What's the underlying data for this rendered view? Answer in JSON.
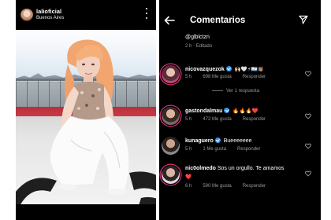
{
  "post": {
    "username": "lalioficial",
    "location": "Buenos Aires",
    "icons": {
      "avatar": "avatar",
      "menu": "more-options-icon"
    }
  },
  "comments_panel": {
    "title": "Comentarios",
    "icons": {
      "back": "back-arrow-icon",
      "share": "send-icon",
      "like": "heart-icon"
    },
    "op_comment": {
      "text": "@glblctzn",
      "time": "2 h",
      "separator": "·",
      "edited": "Editado"
    },
    "view_replies": "Ver 1 respuesta",
    "comments": [
      {
        "username": "nicovazquezok",
        "text": "",
        "emojis": "🙌🏻🤍⚡🇦🇷👏🏽",
        "time": "5 h",
        "likes": "698 Me gusta",
        "reply": "Responder"
      },
      {
        "username": "gastondalmau",
        "text": "",
        "emojis": "🔥🔥🔥❤️",
        "time": "5 h",
        "likes": "472 Me gusta",
        "reply": "Responder"
      },
      {
        "username": "kunaguero",
        "text": "Bueeeeeee",
        "emojis": "",
        "time": "5 h",
        "likes": "1 Me gusta",
        "reply": "Responder"
      },
      {
        "username": "nic0olmedo",
        "text": "Sos un orgullo. Te amamos",
        "emojis": "❤️",
        "time": "6 h",
        "likes": "590 Me gusta",
        "reply": "Responder"
      }
    ],
    "colors": {
      "background": "#000000",
      "muted": "#9a9a9a",
      "verified": "#3897f0",
      "story_ring": "#d9327b"
    }
  }
}
